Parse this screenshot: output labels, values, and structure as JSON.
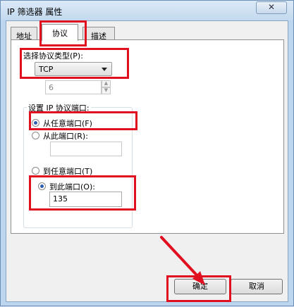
{
  "window": {
    "title": "IP 筛选器 属性",
    "close_glyph": "✕"
  },
  "tabs": [
    {
      "label": "地址",
      "active": false
    },
    {
      "label": "协议",
      "active": true
    },
    {
      "label": "描述",
      "active": false
    }
  ],
  "protocol": {
    "label": "选择协议类型(P):",
    "selected": "TCP",
    "number_value": "6"
  },
  "ports": {
    "group_label": "设置 IP 协议端口:",
    "from_any": "从任意端口(F)",
    "from_this": "从此端口(R):",
    "from_this_value": "",
    "to_any": "到任意端口(T)",
    "to_this": "到此端口(O):",
    "to_this_value": "135",
    "from_any_checked": true,
    "to_this_checked": true
  },
  "buttons": {
    "ok": "确定",
    "cancel": "取消"
  },
  "annotation_color": "#e01020"
}
